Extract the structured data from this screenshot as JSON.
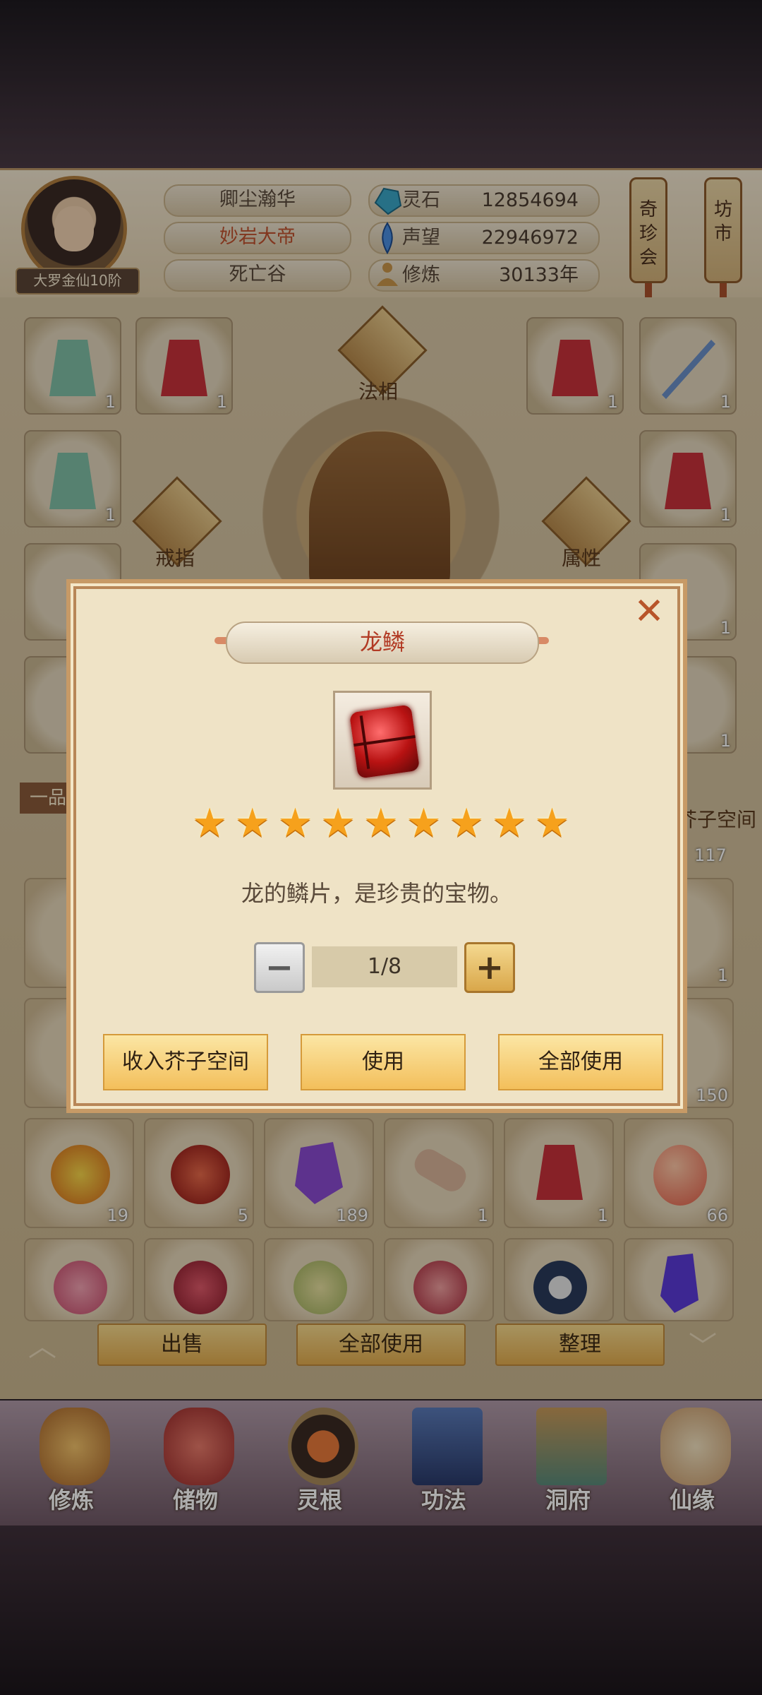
{
  "profile": {
    "rank_badge": "大罗金仙10阶",
    "name": "卿尘瀚华",
    "title": "妙岩大帝",
    "location": "死亡谷",
    "stats": [
      {
        "label": "灵石",
        "value": "12854694",
        "icon": "spirit-stone-icon"
      },
      {
        "label": "声望",
        "value": "22946972",
        "icon": "prestige-icon"
      },
      {
        "label": "修炼",
        "value": "30133年",
        "icon": "meditation-icon"
      }
    ],
    "scroll_buttons": [
      "奇珍会",
      "坊市"
    ]
  },
  "equipment": {
    "labels": {
      "dharma": "法相",
      "ring": "戒指",
      "attribute": "属性"
    },
    "left_slots": [
      {
        "count": "1"
      },
      {
        "count": "1"
      },
      {
        "count": "1"
      }
    ],
    "right_slots": [
      {
        "count": "1"
      },
      {
        "count": "1"
      },
      {
        "count": "1"
      },
      {
        "count": "1"
      },
      {
        "count": "1"
      }
    ]
  },
  "inventory": {
    "grade_tab": "一品",
    "mustard_space": "芥子空间",
    "mustard_count": "117",
    "row1_partial_counts": [
      "1",
      "150"
    ],
    "row2": [
      {
        "count": "19",
        "item": "fire-orb"
      },
      {
        "count": "5",
        "item": "red-orb"
      },
      {
        "count": "189",
        "item": "amethyst"
      },
      {
        "count": "1",
        "item": "scroll"
      },
      {
        "count": "1",
        "item": "robe"
      },
      {
        "count": "66",
        "item": "peach"
      }
    ]
  },
  "actions": {
    "sell": "出售",
    "use_all": "全部使用",
    "sort": "整理"
  },
  "nav": [
    {
      "label": "修炼",
      "icon": "cultivate-icon"
    },
    {
      "label": "储物",
      "icon": "storage-bag-icon"
    },
    {
      "label": "灵根",
      "icon": "spirit-root-icon"
    },
    {
      "label": "功法",
      "icon": "technique-book-icon"
    },
    {
      "label": "洞府",
      "icon": "cave-mansion-icon"
    },
    {
      "label": "仙缘",
      "icon": "immortal-fate-icon"
    }
  ],
  "dialog": {
    "title": "龙鳞",
    "close": "✕",
    "stars": 9,
    "star_glyph": "★",
    "description": "龙的鳞片，是珍贵的宝物。",
    "quantity": "1/8",
    "minus": "−",
    "plus": "+",
    "buttons": {
      "store": "收入芥子空间",
      "use": "使用",
      "use_all": "全部使用"
    }
  }
}
